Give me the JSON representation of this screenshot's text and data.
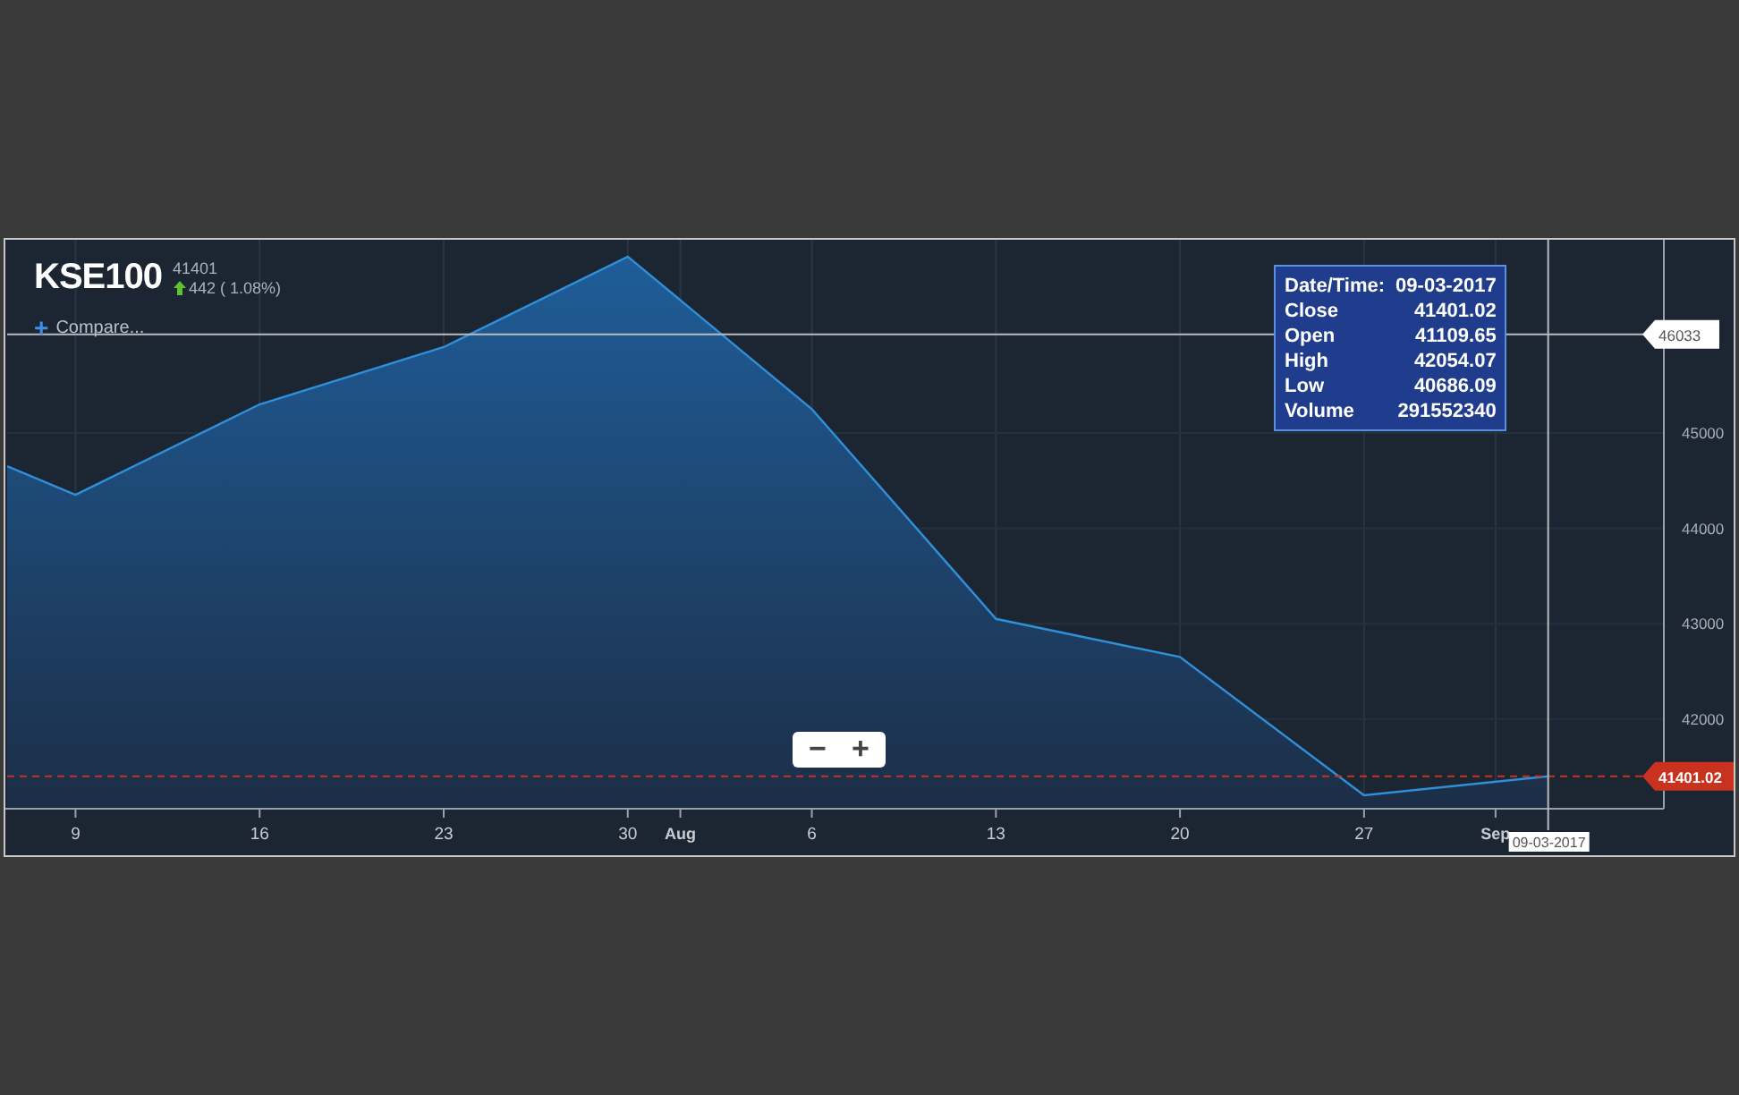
{
  "header": {
    "symbol": "KSE100",
    "price": "41401",
    "change": "442 ( 1.08%)",
    "compare_icon": "+",
    "compare_label": "Compare..."
  },
  "tooltip": {
    "rows": [
      {
        "label": "Date/Time:",
        "value": "09-03-2017"
      },
      {
        "label": "Close",
        "value": "41401.02"
      },
      {
        "label": "Open",
        "value": "41109.65"
      },
      {
        "label": "High",
        "value": "42054.07"
      },
      {
        "label": "Low",
        "value": "40686.09"
      },
      {
        "label": "Volume",
        "value": "291552340"
      }
    ]
  },
  "zoom_buttons": [
    "−",
    "+"
  ],
  "chart_data": {
    "type": "area",
    "x": [
      "2017-07-06T09:36",
      "2017-07-09",
      "2017-07-16",
      "2017-07-23",
      "2017-07-30",
      "2017-08-06",
      "2017-08-13",
      "2017-08-20",
      "2017-08-27",
      "2017-09-03"
    ],
    "series": [
      {
        "color": "#2f8fd8",
        "values": [
          44650,
          44350,
          45300,
          45900,
          46850,
          45250,
          43050,
          42650,
          41200,
          41400
        ]
      }
    ],
    "xlim": [
      "2017-07-06T09:36",
      "2017-09-07T09:36"
    ],
    "ylim": [
      41060,
      47007
    ],
    "xticks": [
      {
        "value": "2017-07-09",
        "label": "9"
      },
      {
        "value": "2017-07-16",
        "label": "16"
      },
      {
        "value": "2017-07-23",
        "label": "23"
      },
      {
        "value": "2017-07-30",
        "label": "30"
      },
      {
        "value": "2017-08-01",
        "label": "Aug"
      },
      {
        "value": "2017-08-06",
        "label": "6"
      },
      {
        "value": "2017-08-13",
        "label": "13"
      },
      {
        "value": "2017-08-20",
        "label": "20"
      },
      {
        "value": "2017-08-27",
        "label": "27"
      },
      {
        "value": "2017-09-01",
        "label": "Sep"
      }
    ],
    "yticks": [
      42000,
      43000,
      44000,
      45000
    ],
    "grid": true,
    "ref_lines": [
      {
        "axis": "y",
        "value": 41401.02,
        "label": "41401.02",
        "color": "#c8321e"
      },
      {
        "axis": "y",
        "value": 46033,
        "label": "46033",
        "color": "#b8bcc0"
      },
      {
        "axis": "x",
        "value": "2017-09-03",
        "label": "09-03-2017",
        "color": "#b8bcc0"
      }
    ]
  }
}
